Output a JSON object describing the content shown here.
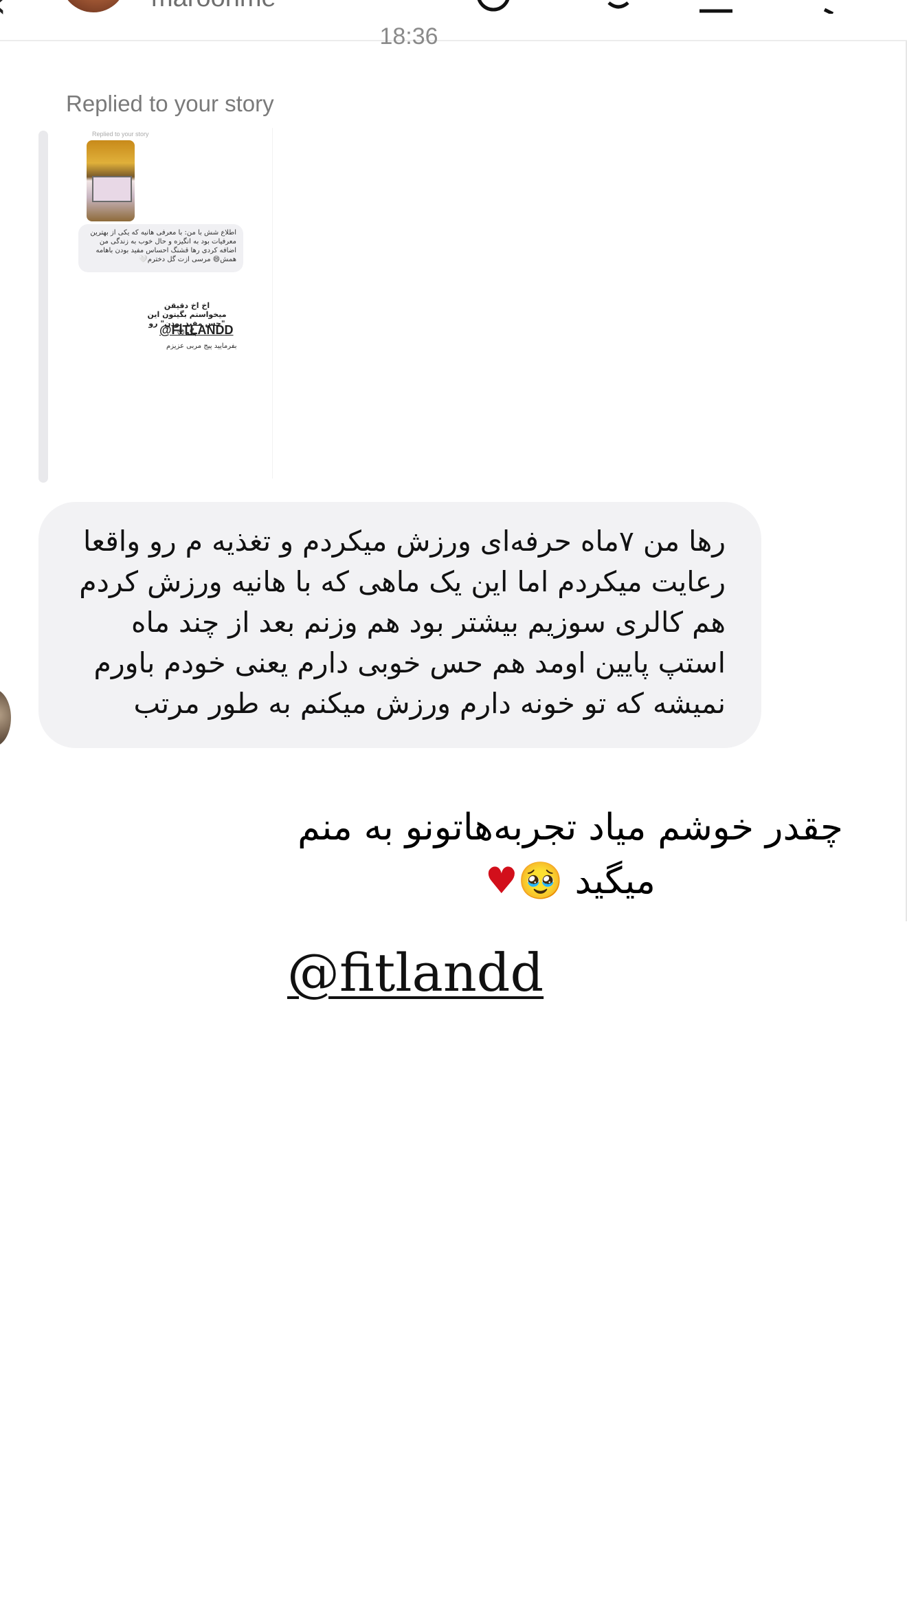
{
  "header": {
    "username": "maroonme",
    "icons": [
      "back-arrow-icon",
      "avatar",
      "phone-icon",
      "video-icon",
      "info-icon",
      "more-icon"
    ]
  },
  "thread": {
    "timestamp": "18:36",
    "replied_label": "Replied to your story",
    "story": {
      "mini_caption": "Replied to your story",
      "bubble_text": "اطلاع شش با من: با معرفی هانیه که یکی از بهترین معرفیات بود به انگیزه و حال خوب به زندگی من اضافه کردی رها قشنگ احساس مفید بودن باهامه همش😄 مرسی ازت گل دخترم🤍",
      "text": "اخ اخ دقیقن میخواستم بگیتون این \"حس مفید بودن\" رو بگه😎",
      "handle": "@FITLANDD",
      "sub": "بفرمایید پیج مربی عزیزم"
    },
    "message": "رها من ۷ماه حرفه‌ای ورزش میکردم و تغذیه م رو واقعا رعایت میکردم اما این یک ماهی که با هانیه ورزش کردم هم کالری سوزیم بیشتر بود هم وزنم بعد از چند ماه استپ پایین اومد هم حس خوبی دارم یعنی خودم باورم نمیشه که تو خونه دارم ورزش میکنم به طور مرتب"
  },
  "overlay": {
    "caption_line1": "چقدر خوشم میاد تجربه‌هاتونو به منم",
    "caption_line2_text": "میگید",
    "caption_line2_emoji": "🥹",
    "caption_line2_heart": "♥",
    "handle": "@fitlandd"
  },
  "colors": {
    "bubble_bg": "#f2f2f4",
    "heart": "#d20f1b",
    "secondary_text": "#7a7a7a"
  }
}
